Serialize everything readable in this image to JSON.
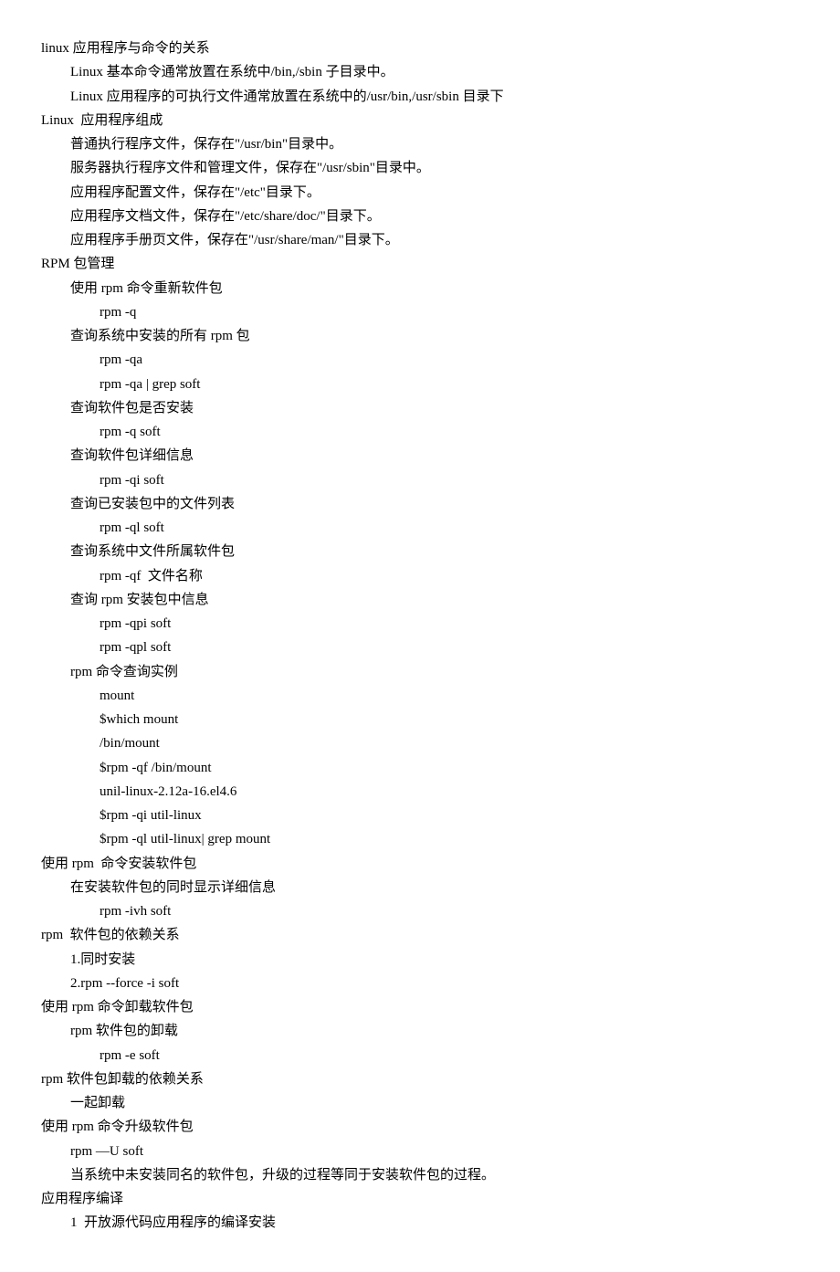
{
  "lines": [
    {
      "indent": 0,
      "text": "linux 应用程序与命令的关系"
    },
    {
      "indent": 1,
      "text": "Linux 基本命令通常放置在系统中/bin,/sbin 子目录中。"
    },
    {
      "indent": 1,
      "text": "Linux 应用程序的可执行文件通常放置在系统中的/usr/bin,/usr/sbin 目录下"
    },
    {
      "indent": 0,
      "text": "Linux  应用程序组成"
    },
    {
      "indent": 1,
      "text": "普通执行程序文件，保存在\"/usr/bin\"目录中。"
    },
    {
      "indent": 1,
      "text": "服务器执行程序文件和管理文件，保存在\"/usr/sbin\"目录中。"
    },
    {
      "indent": 1,
      "text": "应用程序配置文件，保存在\"/etc\"目录下。"
    },
    {
      "indent": 1,
      "text": "应用程序文档文件，保存在\"/etc/share/doc/\"目录下。"
    },
    {
      "indent": 1,
      "text": "应用程序手册页文件，保存在\"/usr/share/man/\"目录下。"
    },
    {
      "indent": 0,
      "text": "RPM 包管理"
    },
    {
      "indent": 1,
      "text": "使用 rpm 命令重新软件包"
    },
    {
      "indent": 2,
      "text": "rpm -q"
    },
    {
      "indent": 1,
      "text": "查询系统中安装的所有 rpm 包"
    },
    {
      "indent": 2,
      "text": "rpm -qa"
    },
    {
      "indent": 2,
      "text": "rpm -qa | grep soft"
    },
    {
      "indent": 1,
      "text": "查询软件包是否安装"
    },
    {
      "indent": 2,
      "text": "rpm -q soft"
    },
    {
      "indent": 1,
      "text": "查询软件包详细信息"
    },
    {
      "indent": 2,
      "text": "rpm -qi soft"
    },
    {
      "indent": 1,
      "text": "查询已安装包中的文件列表"
    },
    {
      "indent": 2,
      "text": "rpm -ql soft"
    },
    {
      "indent": 1,
      "text": "查询系统中文件所属软件包"
    },
    {
      "indent": 2,
      "text": "rpm -qf  文件名称"
    },
    {
      "indent": 1,
      "text": "查询 rpm 安装包中信息"
    },
    {
      "indent": 2,
      "text": "rpm -qpi soft"
    },
    {
      "indent": 2,
      "text": "rpm -qpl soft"
    },
    {
      "indent": 1,
      "text": "rpm 命令查询实例"
    },
    {
      "indent": 2,
      "text": "mount"
    },
    {
      "indent": 2,
      "text": "$which mount"
    },
    {
      "indent": 2,
      "text": "/bin/mount"
    },
    {
      "indent": 2,
      "text": "$rpm -qf /bin/mount"
    },
    {
      "indent": 2,
      "text": "unil-linux-2.12a-16.el4.6"
    },
    {
      "indent": 2,
      "text": "$rpm -qi util-linux"
    },
    {
      "indent": 2,
      "text": "$rpm -ql util-linux| grep mount"
    },
    {
      "indent": 0,
      "text": "使用 rpm  命令安装软件包"
    },
    {
      "indent": 1,
      "text": "在安装软件包的同时显示详细信息"
    },
    {
      "indent": 2,
      "text": "rpm -ivh soft"
    },
    {
      "indent": 0,
      "text": "rpm  软件包的依赖关系"
    },
    {
      "indent": 1,
      "text": "1.同时安装"
    },
    {
      "indent": 1,
      "text": "2.rpm --force -i soft"
    },
    {
      "indent": 0,
      "text": "使用 rpm 命令卸载软件包"
    },
    {
      "indent": 1,
      "text": "rpm 软件包的卸载"
    },
    {
      "indent": 2,
      "text": "rpm -e soft"
    },
    {
      "indent": 0,
      "text": "rpm 软件包卸载的依赖关系"
    },
    {
      "indent": 1,
      "text": "一起卸载"
    },
    {
      "indent": 0,
      "text": "使用 rpm 命令升级软件包"
    },
    {
      "indent": 1,
      "text": "rpm —U soft"
    },
    {
      "indent": 1,
      "text": "当系统中未安装同名的软件包，升级的过程等同于安装软件包的过程。"
    },
    {
      "indent": 0,
      "text": "应用程序编译"
    },
    {
      "indent": 1,
      "text": "1  开放源代码应用程序的编译安装"
    }
  ]
}
